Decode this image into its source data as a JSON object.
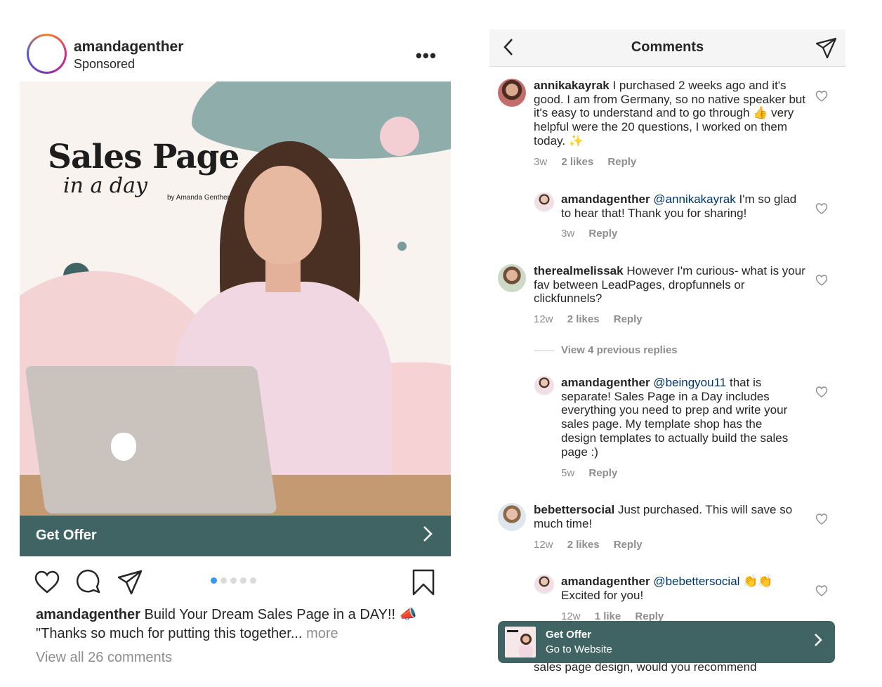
{
  "post": {
    "username": "amandagenther",
    "sponsored": "Sponsored",
    "more": "•••",
    "image": {
      "title_main": "Sales Page",
      "title_script": "in a day",
      "title_by": "by Amanda Genther"
    },
    "offer_label": "Get Offer",
    "offer_chevron": "›",
    "caption_user": "amandagenther",
    "caption_text": "Build Your Dream Sales Page in a DAY!! 📣 \"Thanks so much for putting this together...",
    "caption_more": "more",
    "view_all": "View all 26 comments",
    "pager_total": 5,
    "pager_active": 1
  },
  "comments": {
    "title": "Comments",
    "items": [
      {
        "user": "annikakayrak",
        "text": "I purchased 2 weeks ago and it's good. I am from Germany, so no native speaker but it's easy to understand and to go through 👍 very helpful were the 20 questions, I worked on them today. ✨",
        "time": "3w",
        "likes": "2 likes",
        "reply": "Reply"
      },
      {
        "user": "amandagenther",
        "mention": "@annikakayrak",
        "text": "I'm so glad to hear that! Thank you for sharing!",
        "time": "3w",
        "reply": "Reply"
      },
      {
        "user": "therealmelissak",
        "text": "However I'm curious- what is your fav between LeadPages, dropfunnels or clickfunnels?",
        "time": "12w",
        "likes": "2 likes",
        "reply": "Reply"
      },
      {
        "user": "amandagenther",
        "mention": "@beingyou11",
        "text": "that is separate! Sales Page in a Day includes everything you need to prep and write your sales page. My template shop has the design templates to actually build the sales page :)",
        "time": "5w",
        "reply": "Reply"
      },
      {
        "user": "bebettersocial",
        "text": "Just purchased. This will save so much time!",
        "time": "12w",
        "likes": "2 likes",
        "reply": "Reply"
      },
      {
        "user": "amandagenther",
        "mention": "@bebettersocial",
        "text": "👏👏 Excited for you!",
        "time": "12w",
        "likes": "1 like",
        "reply": "Reply"
      }
    ],
    "view_previous": "View 4 previous replies",
    "cta_title": "Get Offer",
    "cta_subtitle": "Go to Website",
    "cut_text": "sales page design, would you recommend"
  },
  "colors": {
    "offer_bar": "#3f6463",
    "mention": "#003569",
    "pager_active": "#3897f0"
  }
}
